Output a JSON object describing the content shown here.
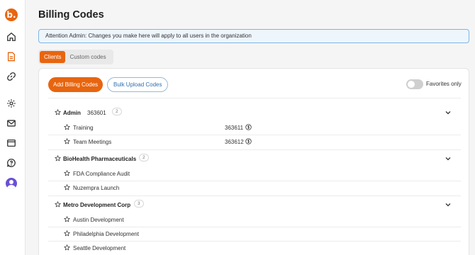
{
  "app": {
    "logo_letter": "b.",
    "page_title": "Billing Codes"
  },
  "sidebar": {
    "items": [
      {
        "name": "home-icon"
      },
      {
        "name": "document-icon",
        "active": true
      },
      {
        "name": "link-icon"
      },
      {
        "name": "gear-icon"
      },
      {
        "name": "mail-icon"
      },
      {
        "name": "browser-window-icon"
      },
      {
        "name": "help-chat-icon"
      }
    ],
    "avatar_color": "#6a4fd8"
  },
  "alert": {
    "text": "Attention Admin: Changes you make here will apply to all users in the organization"
  },
  "tabs": [
    {
      "label": "Clients",
      "active": true
    },
    {
      "label": "Custom codes",
      "active": false
    }
  ],
  "toolbar": {
    "add_label": "Add Billing Codes",
    "bulk_label": "Bulk Upload Codes",
    "favorites_label": "Favorites only",
    "favorites_on": false
  },
  "groups": [
    {
      "name": "Admin",
      "code": "363601",
      "count": "2",
      "items": [
        {
          "name": "Training",
          "code": "363611"
        },
        {
          "name": "Team Meetings",
          "code": "363612"
        }
      ]
    },
    {
      "name": "BioHealth Pharmaceuticals",
      "code": "",
      "count": "2",
      "items": [
        {
          "name": "FDA Compliance Audit",
          "code": ""
        },
        {
          "name": "Nuzempra Launch",
          "code": ""
        }
      ]
    },
    {
      "name": "Metro Development Corp",
      "code": "",
      "count": "3",
      "items": [
        {
          "name": "Austin Development",
          "code": ""
        },
        {
          "name": "Philadelphia Development",
          "code": ""
        },
        {
          "name": "Seattle Development",
          "code": ""
        }
      ]
    }
  ],
  "colors": {
    "accent": "#e8650f",
    "link": "#2f6fb0",
    "alert_bg": "#eef6fc",
    "alert_border": "#7cb5e6"
  }
}
